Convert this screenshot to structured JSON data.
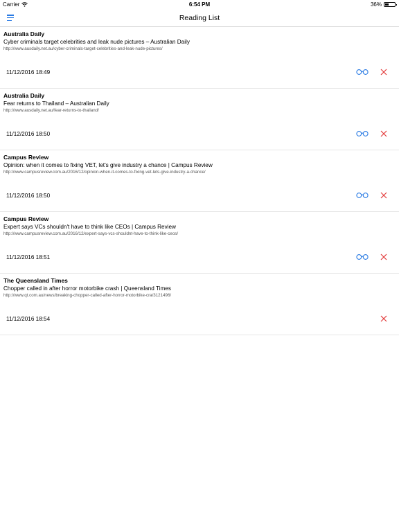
{
  "status_bar": {
    "carrier": "Carrier",
    "time": "6:54 PM",
    "battery_text": "36%",
    "battery_level": 0.36
  },
  "nav": {
    "title": "Reading List"
  },
  "colors": {
    "accent": "#2a7be4",
    "delete": "#e23b3b"
  },
  "items": [
    {
      "source": "Australia Daily",
      "headline": "Cyber criminals target celebrities and leak nude pictures – Australian Daily",
      "url": "http://www.ausdaily.net.au/cyber-criminals-target-celebrities-and-leak-nude-pictures/",
      "timestamp": "11/12/2016 18:49",
      "has_read_icon": true
    },
    {
      "source": "Australia Daily",
      "headline": "Fear returns to Thailand – Australian Daily",
      "url": "http://www.ausdaily.net.au/fear-returns-to-thailand/",
      "timestamp": "11/12/2016 18:50",
      "has_read_icon": true
    },
    {
      "source": "Campus Review",
      "headline": "Opinion: when it comes to fixing VET, let's give industry a chance | Campus Review",
      "url": "http://www.campusreview.com.au/2016/12/opinion-when-it-comes-to-fixing-vet-lets-give-industry-a-chance/",
      "timestamp": "11/12/2016 18:50",
      "has_read_icon": true
    },
    {
      "source": "Campus Review",
      "headline": "Expert says VCs shouldn't have to think like CEOs | Campus Review",
      "url": "http://www.campusreview.com.au/2016/12/expert-says-vcs-shouldnt-have-to-think-like-ceos/",
      "timestamp": "11/12/2016 18:51",
      "has_read_icon": true
    },
    {
      "source": "The Queensland Times",
      "headline": "Chopper called in after horror motorbike crash | Queensland Times",
      "url": "http://www.qt.com.au/news/breaking-chopper-called-after-horror-motorbike-cra/3121496/",
      "timestamp": "11/12/2016 18:54",
      "has_read_icon": false
    }
  ]
}
